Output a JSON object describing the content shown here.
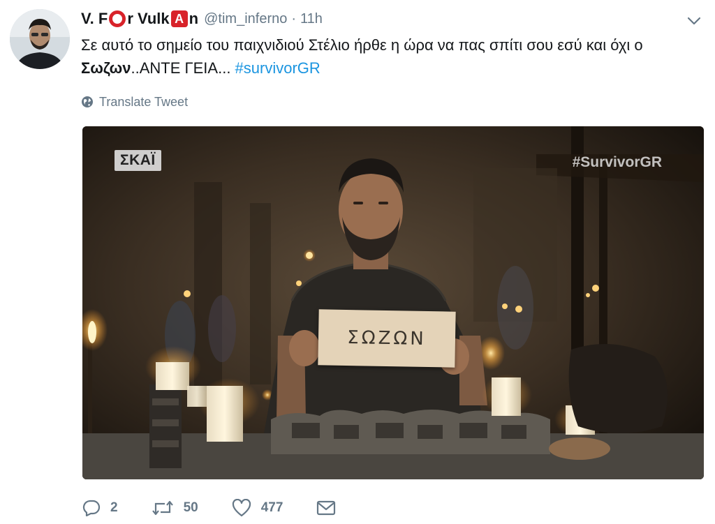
{
  "tweet": {
    "display_name_part1": "V. F",
    "display_name_part2": "r Vulk",
    "display_name_part3": "n",
    "emoji_a_letter": "A",
    "handle": "@tim_inferno",
    "separator": "·",
    "time": "11h",
    "text_part1": "Σε αυτό το σημείο του παιχνιδιού Στέλιο ήρθε η ώρα να πας σπίτι σου εσύ και όχι ο ",
    "text_bold": "Σωζων",
    "text_part2": "..ΑΝΤΕ ΓΕΙΑ... ",
    "hashtag": "#survivorGR",
    "translate_label": "Translate Tweet"
  },
  "media": {
    "channel_logo": "ΣΚΑΪ",
    "watermark": "#SurvivorGR",
    "sign_text": "ΣΩΖΩΝ"
  },
  "actions": {
    "replies": "2",
    "retweets": "50",
    "likes": "477"
  },
  "icons": {
    "caret": "chevron-down-icon",
    "translate": "globe-icon",
    "reply": "reply-icon",
    "retweet": "retweet-icon",
    "like": "heart-icon",
    "message": "envelope-icon"
  },
  "colors": {
    "name": "#14171a",
    "muted": "#657786",
    "link": "#1b95e0",
    "emoji_red": "#d8232a"
  }
}
